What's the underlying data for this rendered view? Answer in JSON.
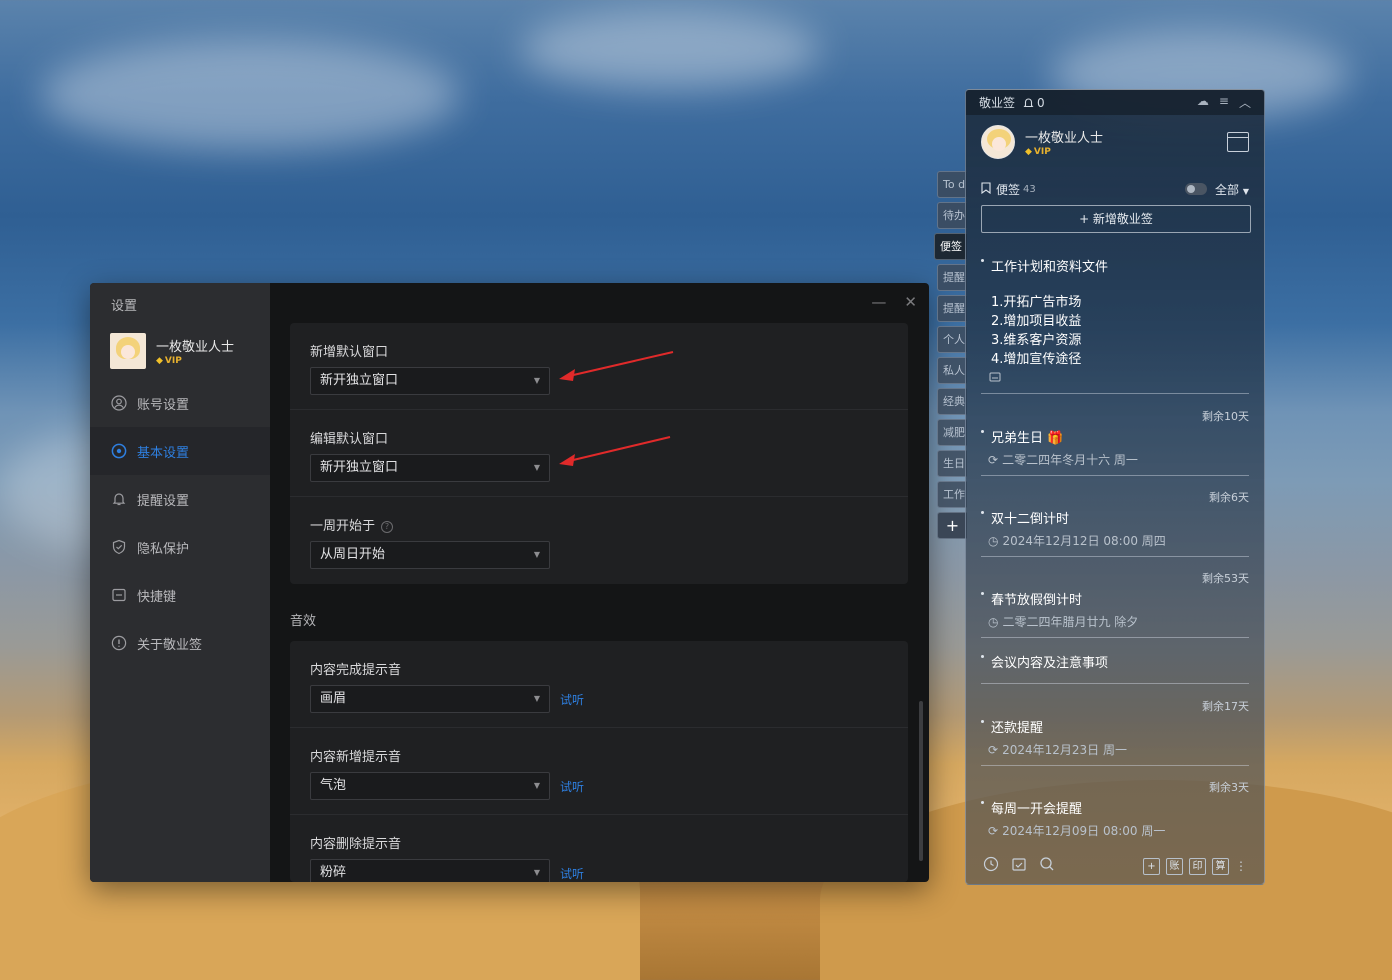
{
  "settings": {
    "title": "设置",
    "user": {
      "name": "一枚敬业人士",
      "vip": "VIP"
    },
    "menu": [
      {
        "label": "账号设置",
        "icon": "user-icon"
      },
      {
        "label": "基本设置",
        "icon": "settings-icon",
        "active": true
      },
      {
        "label": "提醒设置",
        "icon": "bell-icon"
      },
      {
        "label": "隐私保护",
        "icon": "shield-icon"
      },
      {
        "label": "快捷键",
        "icon": "keyboard-icon"
      },
      {
        "label": "关于敬业签",
        "icon": "info-icon"
      }
    ],
    "window_controls": {
      "minimize": "—",
      "close": "✕"
    },
    "rows": [
      {
        "label": "新增默认窗口",
        "value": "新开独立窗口"
      },
      {
        "label": "编辑默认窗口",
        "value": "新开独立窗口"
      },
      {
        "label": "一周开始于",
        "value": "从周日开始",
        "help": "?"
      }
    ],
    "sound_section": "音效",
    "sound_rows": [
      {
        "label": "内容完成提示音",
        "value": "画眉",
        "action": "试听"
      },
      {
        "label": "内容新增提示音",
        "value": "气泡",
        "action": "试听"
      },
      {
        "label": "内容删除提示音",
        "value": "粉碎",
        "action": "试听"
      }
    ]
  },
  "side_tabs": [
    "To d",
    "待办",
    "便签",
    "提醒",
    "提醒",
    "个人",
    "私人",
    "经典",
    "减肥",
    "生日",
    "工作",
    "+"
  ],
  "notes_panel": {
    "app_name": "敬业签",
    "bell_count": "0",
    "user": {
      "name": "一枚敬业人士",
      "vip": "VIP"
    },
    "filter": {
      "label": "便签",
      "count": "43",
      "scope": "全部"
    },
    "add_label": "+ 新增敬业签",
    "notes": [
      {
        "title": "工作计划和资料文件",
        "body": [
          "1.开拓广告市场",
          "2.增加项目收益",
          "3.维系客户资源",
          "4.增加宣传途径"
        ]
      },
      {
        "remain": "剩余10天",
        "title": "兄弟生日",
        "meta": "二零二四年冬月十六 周一"
      },
      {
        "remain": "剩余6天",
        "title": "双十二倒计时",
        "meta": "2024年12月12日 08:00 周四"
      },
      {
        "remain": "剩余53天",
        "title": "春节放假倒计时",
        "meta": "二零二四年腊月廿九 除夕"
      },
      {
        "title": "会议内容及注意事项"
      },
      {
        "remain": "剩余17天",
        "title": "还款提醒",
        "meta": "2024年12月23日 周一"
      },
      {
        "remain": "剩余3天",
        "title": "每周一开会提醒",
        "meta": "2024年12月09日 08:00 周一"
      }
    ],
    "bottom_buttons": [
      "+",
      "账",
      "印",
      "算"
    ]
  },
  "colors": {
    "accent": "#2e7fe0",
    "annotation_arrow": "#e02a2a"
  }
}
